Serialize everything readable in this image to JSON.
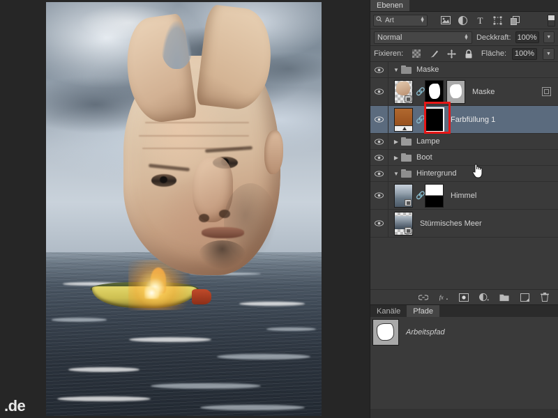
{
  "app": {
    "watermark": ".de"
  },
  "panel": {
    "tabs": [
      {
        "label": "Ebenen",
        "active": true
      }
    ],
    "filter": {
      "kind_label": "Art",
      "search_icon": "search-icon",
      "icons": [
        {
          "name": "pixel-layer-filter-icon",
          "glyph": "image"
        },
        {
          "name": "adjustment-layer-filter-icon",
          "glyph": "circle-half"
        },
        {
          "name": "type-layer-filter-icon",
          "glyph": "T"
        },
        {
          "name": "shape-layer-filter-icon",
          "glyph": "shape"
        },
        {
          "name": "smart-object-filter-icon",
          "glyph": "smart"
        }
      ],
      "toggle_name": "filter-enable-toggle"
    },
    "blend": {
      "mode": "Normal",
      "opacity_label": "Deckkraft:",
      "opacity_value": "100%"
    },
    "lock": {
      "label": "Fixieren:",
      "fill_label": "Fläche:",
      "fill_value": "100%",
      "icons": [
        {
          "name": "lock-transparent-pixels-icon"
        },
        {
          "name": "lock-image-pixels-icon"
        },
        {
          "name": "lock-position-icon"
        },
        {
          "name": "lock-all-icon"
        }
      ]
    },
    "layers": [
      {
        "id": "maske-group",
        "type": "group",
        "name": "Maske",
        "expanded": true,
        "visible": true,
        "selected": false
      },
      {
        "id": "maske-layer",
        "type": "layer",
        "name": "Maske",
        "visible": true,
        "selected": false,
        "has_link": true,
        "has_mask": true,
        "has_vector_mask": true,
        "has_smart_indicator": true
      },
      {
        "id": "farbfuellung-1",
        "type": "fill",
        "name": "Farbfüllung 1",
        "visible": true,
        "selected": true,
        "has_link": true,
        "mask_selected": true,
        "highlight": true
      },
      {
        "id": "lampe-group",
        "type": "group",
        "name": "Lampe",
        "expanded": false,
        "visible": true,
        "selected": false
      },
      {
        "id": "boot-group",
        "type": "group",
        "name": "Boot",
        "expanded": false,
        "visible": true,
        "selected": false
      },
      {
        "id": "hintergrund-group",
        "type": "group",
        "name": "Hintergrund",
        "expanded": true,
        "visible": true,
        "selected": false
      },
      {
        "id": "himmel",
        "type": "layer",
        "name": "Himmel",
        "visible": true,
        "selected": false,
        "has_link": true,
        "has_mask": true
      },
      {
        "id": "stuermisches-meer",
        "type": "layer",
        "name": "Stürmisches Meer",
        "visible": true,
        "selected": false,
        "has_link": false,
        "has_mask": false
      }
    ],
    "bottom_icons": [
      {
        "name": "link-layers-icon"
      },
      {
        "name": "layer-style-fx-icon",
        "glyph": "fx"
      },
      {
        "name": "add-layer-mask-icon"
      },
      {
        "name": "new-adjustment-layer-icon"
      },
      {
        "name": "new-group-icon"
      },
      {
        "name": "new-layer-icon"
      },
      {
        "name": "delete-layer-icon"
      }
    ]
  },
  "lower_panel": {
    "tabs": [
      {
        "label": "Kanäle",
        "active": false
      },
      {
        "label": "Pfade",
        "active": true
      }
    ],
    "paths": [
      {
        "name": "Arbeitspfad"
      }
    ]
  },
  "colors": {
    "panel_bg": "#3a3a3a",
    "tab_bg": "#2b2b2b",
    "selection": "#5b6b7e",
    "highlight_box": "#e61717",
    "text": "#d2d2d2"
  }
}
